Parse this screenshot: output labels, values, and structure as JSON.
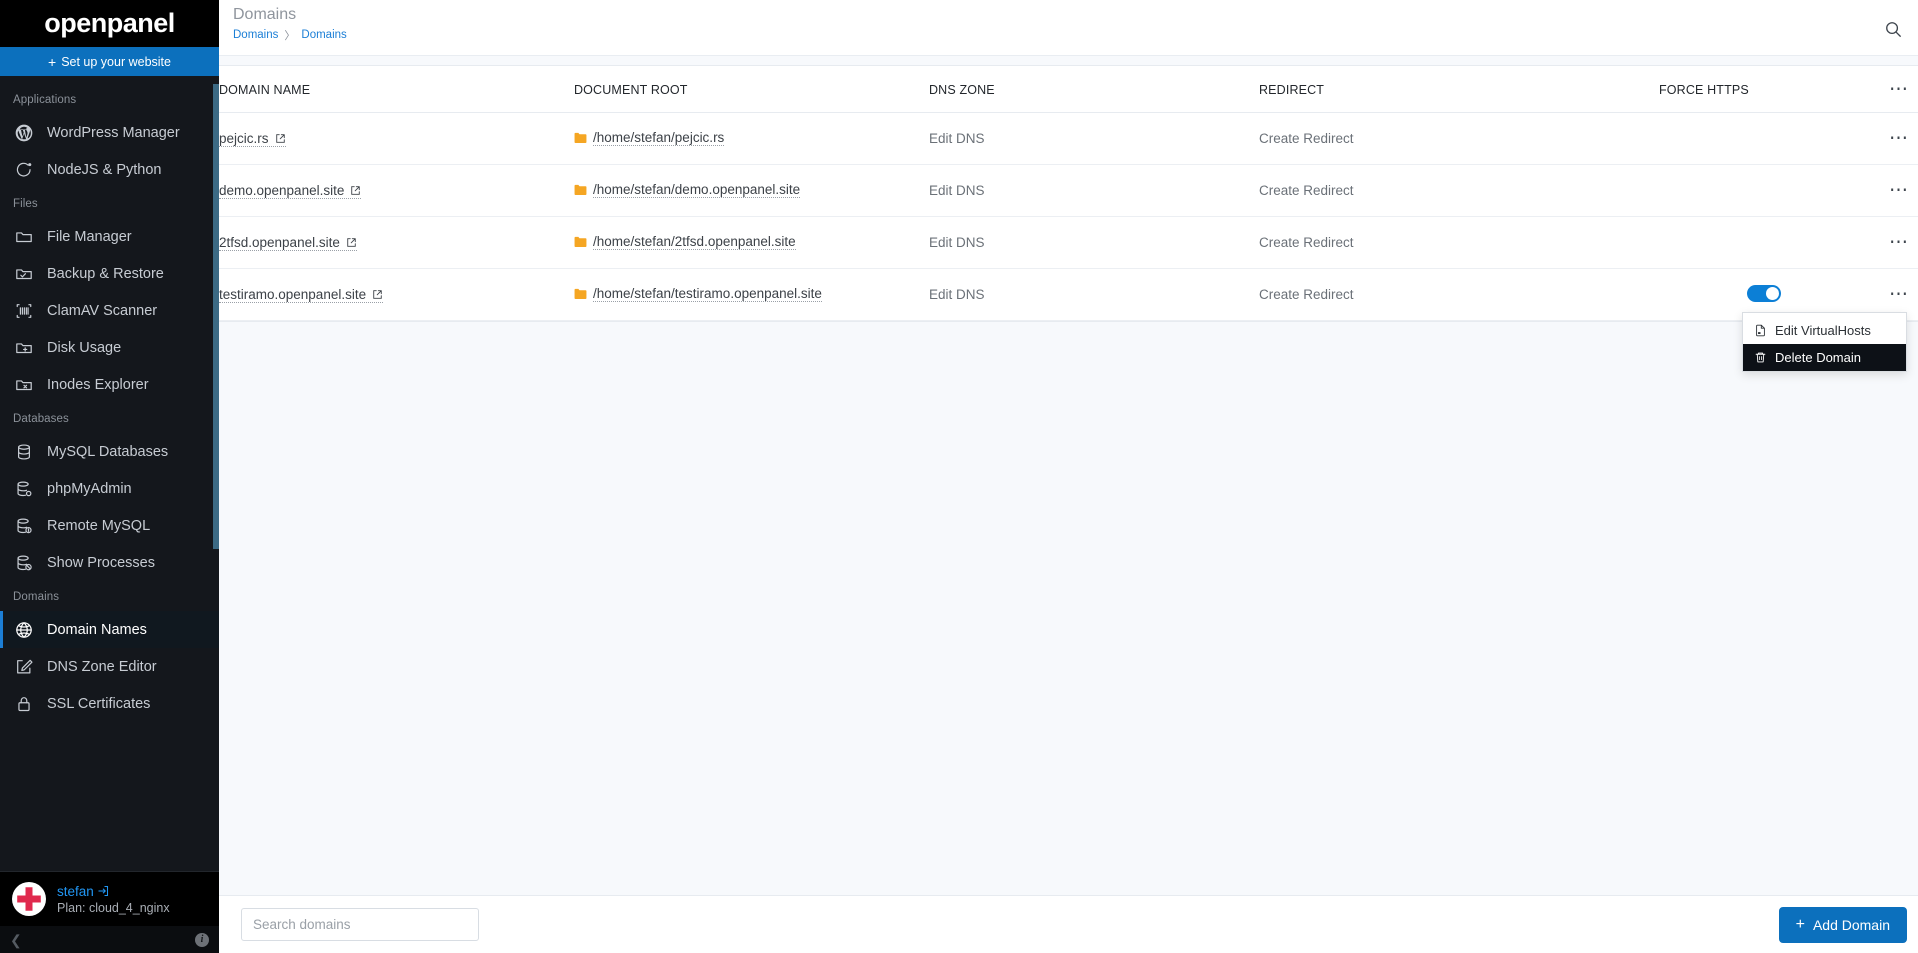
{
  "brand": {
    "name": "openpanel"
  },
  "setup": {
    "label": "Set up your website",
    "icon": "plus-icon"
  },
  "sidebar": {
    "sections": [
      {
        "label": "Applications",
        "items": [
          {
            "label": "WordPress Manager",
            "icon": "wordpress-icon",
            "active": false
          },
          {
            "label": "NodeJS & Python",
            "icon": "nodejs-icon",
            "active": false
          }
        ]
      },
      {
        "label": "Files",
        "items": [
          {
            "label": "File Manager",
            "icon": "folder-icon",
            "active": false
          },
          {
            "label": "Backup & Restore",
            "icon": "folder-check-icon",
            "active": false
          },
          {
            "label": "ClamAV Scanner",
            "icon": "scan-icon",
            "active": false
          },
          {
            "label": "Disk Usage",
            "icon": "folder-plus-icon",
            "active": false
          },
          {
            "label": "Inodes Explorer",
            "icon": "folder-x-icon",
            "active": false
          }
        ]
      },
      {
        "label": "Databases",
        "items": [
          {
            "label": "MySQL Databases",
            "icon": "database-icon",
            "active": false
          },
          {
            "label": "phpMyAdmin",
            "icon": "database-gear-icon",
            "active": false
          },
          {
            "label": "Remote MySQL",
            "icon": "database-info-icon",
            "active": false
          },
          {
            "label": "Show Processes",
            "icon": "database-block-icon",
            "active": false
          }
        ]
      },
      {
        "label": "Domains",
        "items": [
          {
            "label": "Domain Names",
            "icon": "globe-icon",
            "active": true
          },
          {
            "label": "DNS Zone Editor",
            "icon": "edit-square-icon",
            "active": false
          },
          {
            "label": "SSL Certificates",
            "icon": "lock-icon",
            "active": false
          }
        ]
      }
    ],
    "user": {
      "name": "stefan",
      "plan": "Plan: cloud_4_nginx",
      "logout_icon": "logout-icon",
      "avatar_icon": "lifebuoy-avatar"
    },
    "footer": {
      "collapse_icon": "chevron-left-icon",
      "info_icon": "info-icon"
    }
  },
  "header": {
    "title": "Domains",
    "breadcrumb": [
      "Domains",
      "Domains"
    ],
    "breadcrumb_separator": "〉",
    "search_icon": "search-icon"
  },
  "table": {
    "columns": [
      "DOMAIN NAME",
      "DOCUMENT ROOT",
      "DNS ZONE",
      "REDIRECT",
      "FORCE HTTPS"
    ],
    "header_actions_icon": "ellipsis-icon",
    "rows": [
      {
        "domain": "pejcic.rs",
        "docroot": "/home/stefan/pejcic.rs",
        "dns": "Edit DNS",
        "redirect": "Create Redirect",
        "force_https": false,
        "highlighted": false
      },
      {
        "domain": "demo.openpanel.site",
        "docroot": "/home/stefan/demo.openpanel.site",
        "dns": "Edit DNS",
        "redirect": "Create Redirect",
        "force_https": false,
        "highlighted": false
      },
      {
        "domain": "2tfsd.openpanel.site",
        "docroot": "/home/stefan/2tfsd.openpanel.site",
        "dns": "Edit DNS",
        "redirect": "Create Redirect",
        "force_https": false,
        "highlighted": true
      },
      {
        "domain": "testiramo.openpanel.site",
        "docroot": "/home/stefan/testiramo.openpanel.site",
        "dns": "Edit DNS",
        "redirect": "Create Redirect",
        "force_https": true,
        "highlighted": false
      }
    ]
  },
  "context_menu": {
    "visible": true,
    "items": [
      {
        "label": "Edit VirtualHosts",
        "icon": "file-icon",
        "selected": false
      },
      {
        "label": "Delete Domain",
        "icon": "trash-icon",
        "selected": true
      }
    ]
  },
  "footer": {
    "search_placeholder": "Search domains",
    "search_value": "",
    "add_button": "Add Domain",
    "add_icon": "plus-icon"
  },
  "colors": {
    "accent": "#0c70bd",
    "sidebar_bg": "#14171c",
    "sidebar_dark": "#0b0d10",
    "toggle_on": "#0c7fd6",
    "folder": "#f5a623",
    "link": "#1c7fd6"
  }
}
